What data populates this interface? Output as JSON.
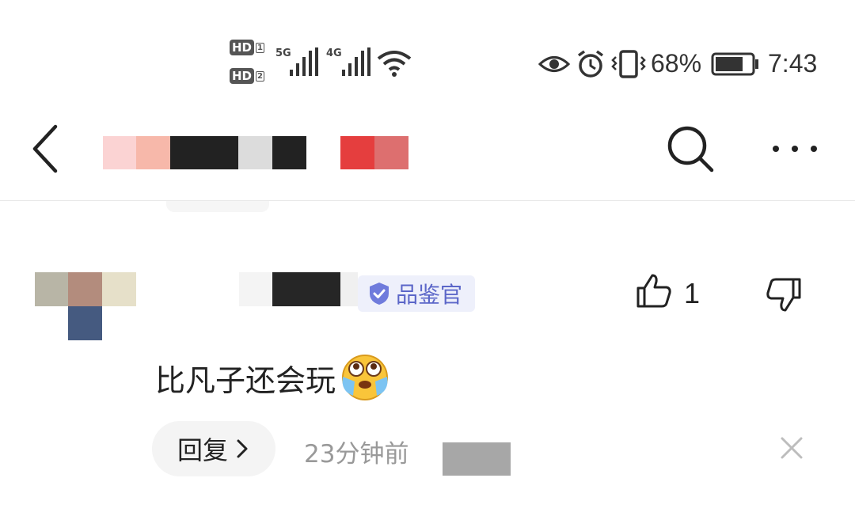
{
  "status_bar": {
    "sim1_label": "HD",
    "sim1_index": "1",
    "sim2_label": "HD",
    "sim2_index": "2",
    "network_5g": "5G",
    "network_4g": "4G",
    "battery_percent": "68%",
    "time": "7:43"
  },
  "header": {
    "back_icon": "back-arrow-icon",
    "search_icon": "search-icon",
    "more_icon": "more-dots-icon"
  },
  "comment": {
    "badge_label": "品鉴官",
    "like_count": "1",
    "text": "比凡子还会玩",
    "emoji": "🥹",
    "reply_label": "回复",
    "timestamp": "23分钟前"
  },
  "colors": {
    "badge_bg": "#eef0fb",
    "badge_text": "#5b66c8",
    "divider": "#e8e8e8"
  }
}
